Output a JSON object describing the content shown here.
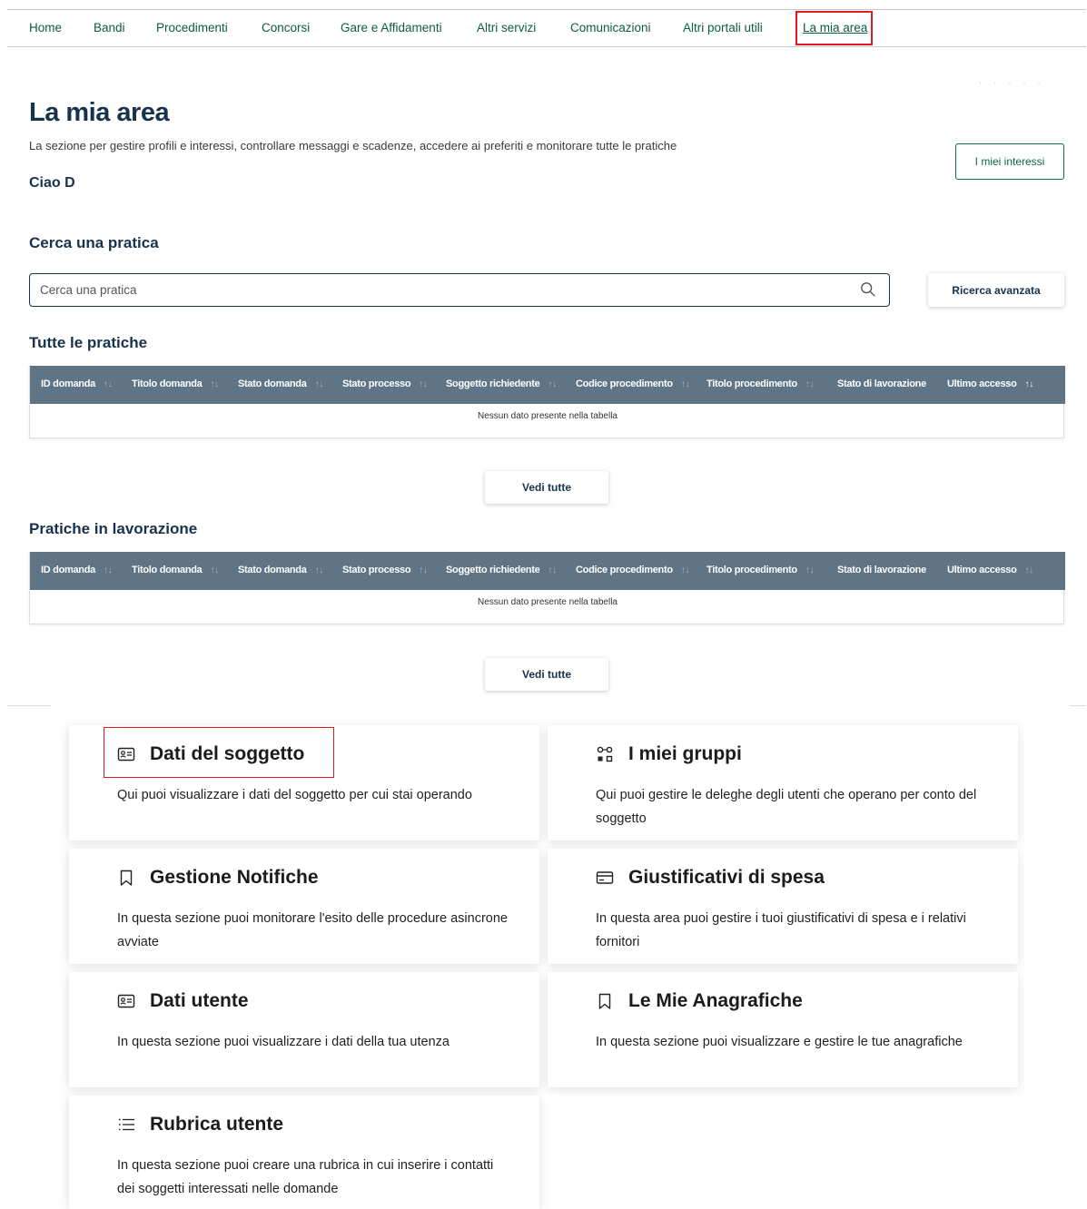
{
  "nav": {
    "items": [
      "Home",
      "Bandi",
      "Procedimenti",
      "Concorsi",
      "Gare e Affidamenti",
      "Altri servizi",
      "Comunicazioni",
      "Altri portali utili",
      "La mia area"
    ],
    "active": "La mia area"
  },
  "page": {
    "title": "La mia area",
    "subtitle": "La sezione per gestire profili e interessi, controllare messaggi e scadenze, accedere ai preferiti e monitorare tutte le pratiche",
    "greeting": "Ciao D",
    "interests_button": "I miei interessi"
  },
  "search": {
    "section_title": "Cerca una pratica",
    "placeholder": "Cerca una pratica",
    "advanced_button": "Ricerca avanzata"
  },
  "table_all": {
    "title": "Tutte le pratiche",
    "columns": [
      "ID domanda",
      "Titolo domanda",
      "Stato domanda",
      "Stato processo",
      "Soggetto richiedente",
      "Codice procedimento",
      "Titolo procedimento",
      "Stato di lavorazione",
      "Ultimo accesso"
    ],
    "empty_text": "Nessun dato presente nella tabella",
    "view_all": "Vedi tutte"
  },
  "table_working": {
    "title": "Pratiche in lavorazione",
    "columns": [
      "ID domanda",
      "Titolo domanda",
      "Stato domanda",
      "Stato processo",
      "Soggetto richiedente",
      "Codice procedimento",
      "Titolo procedimento",
      "Stato di lavorazione",
      "Ultimo accesso"
    ],
    "empty_text": "Nessun dato presente nella tabella",
    "view_all": "Vedi tutte"
  },
  "cards": [
    {
      "icon": "id-card-icon",
      "title": "Dati del soggetto",
      "desc": "Qui puoi visualizzare i dati del soggetto per cui stai operando"
    },
    {
      "icon": "groups-icon",
      "title": "I miei gruppi",
      "desc": "Qui puoi gestire le deleghe degli utenti che operano per conto del soggetto"
    },
    {
      "icon": "bookmark-icon",
      "title": "Gestione Notifiche",
      "desc": "In questa sezione puoi monitorare l'esito delle procedure asincrone avviate"
    },
    {
      "icon": "credit-card-icon",
      "title": "Giustificativi di spesa",
      "desc": "In questa area puoi gestire i tuoi giustificativi di spesa e i relativi fornitori"
    },
    {
      "icon": "id-card-icon",
      "title": "Dati utente",
      "desc": "In questa sezione puoi visualizzare i dati della tua utenza"
    },
    {
      "icon": "bookmark-icon",
      "title": "Le Mie Anagrafiche",
      "desc": "In questa sezione puoi visualizzare e gestire le tue anagrafiche"
    },
    {
      "icon": "list-icon",
      "title": "Rubrica utente",
      "desc": "In questa sezione puoi creare una rubrica in cui inserire i contatti dei soggetti interessati nelle domande"
    }
  ],
  "colors": {
    "brand_green": "#0b5d3c",
    "heading_navy": "#17324d",
    "table_header": "#5f7485",
    "highlight_red": "#e01b1b"
  }
}
